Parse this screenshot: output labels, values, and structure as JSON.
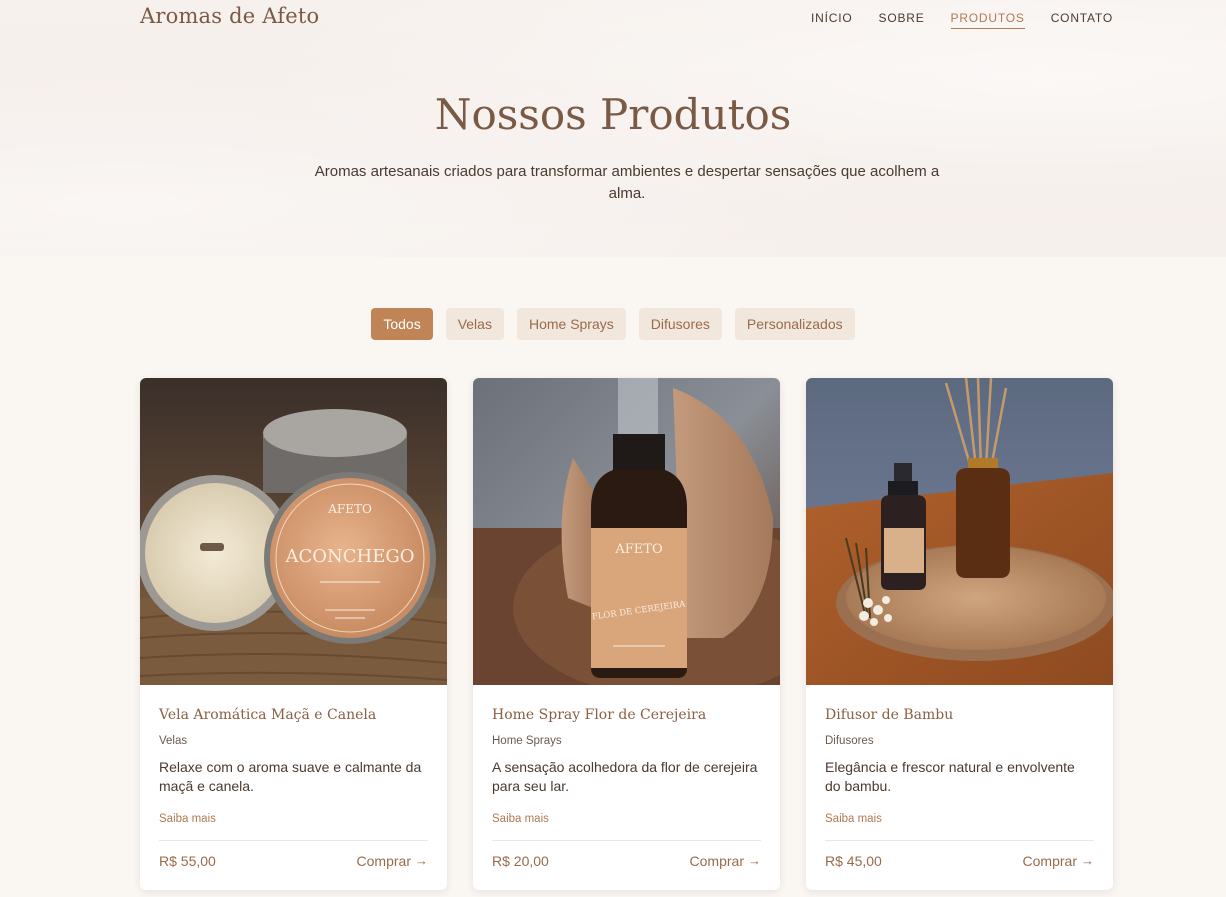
{
  "header": {
    "brand": "Aromas de Afeto",
    "nav": [
      {
        "label": "INÍCIO",
        "active": false
      },
      {
        "label": "SOBRE",
        "active": false
      },
      {
        "label": "PRODUTOS",
        "active": true
      },
      {
        "label": "CONTATO",
        "active": false
      }
    ]
  },
  "hero": {
    "title": "Nossos Produtos",
    "subtitle": "Aromas artesanais criados para transformar ambientes e despertar sensações que acolhem a alma."
  },
  "filters": [
    {
      "label": "Todos",
      "active": true
    },
    {
      "label": "Velas",
      "active": false
    },
    {
      "label": "Home Sprays",
      "active": false
    },
    {
      "label": "Difusores",
      "active": false
    },
    {
      "label": "Personalizados",
      "active": false
    }
  ],
  "products": [
    {
      "title": "Vela Aromática Maçã e Canela",
      "category": "Velas",
      "description": "Relaxe com o aroma suave e calmante da maçã e canela.",
      "more": "Saiba mais",
      "price": "R$ 55,00",
      "buy": "Comprar",
      "image_label": "ACONCHEGO",
      "image_brand": "AFETO"
    },
    {
      "title": "Home Spray Flor de Cerejeira",
      "category": "Home Sprays",
      "description": "A sensação acolhedora da flor de cerejeira para seu lar.",
      "more": "Saiba mais",
      "price": "R$ 20,00",
      "buy": "Comprar",
      "image_label": "FLOR DE CEREJEIRA",
      "image_brand": "AFETO"
    },
    {
      "title": "Difusor de Bambu",
      "category": "Difusores",
      "description": "Elegância e frescor natural e envolvente do bambu.",
      "more": "Saiba mais",
      "price": "R$ 45,00",
      "buy": "Comprar"
    }
  ],
  "colors": {
    "accent": "#c08457",
    "brand_text": "#7a5a45",
    "background": "#faf6f2"
  }
}
